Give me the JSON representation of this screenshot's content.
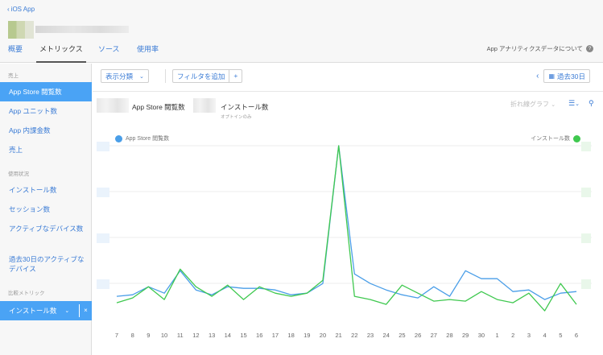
{
  "header": {
    "back_label": "iOS App",
    "about_label": "App アナリティクスデータについて",
    "help_glyph": "?"
  },
  "tabs": [
    {
      "label": "概要"
    },
    {
      "label": "メトリックス"
    },
    {
      "label": "ソース"
    },
    {
      "label": "使用率"
    }
  ],
  "sidebar": {
    "section_sales": "売上",
    "section_usage": "使用状況",
    "section_compare": "比較メトリック",
    "items_sales": [
      "App Store 閲覧数",
      "App ユニット数",
      "App 内課金数",
      "売上"
    ],
    "items_usage": [
      "インストール数",
      "セッション数",
      "アクティブなデバイス数",
      "過去30日のアクティブなデバイス"
    ],
    "compare_value": "インストール数",
    "compare_close": "×"
  },
  "toolbar": {
    "group_label": "表示分類",
    "filter_label": "フィルタを追加",
    "filter_plus": "+",
    "date_label": "過去30日"
  },
  "chart_header": {
    "metric1": "App Store 閲覧数",
    "metric2": "インストール数",
    "metric2_note": "オプトインのみ",
    "chart_type": "折れ線グラフ"
  },
  "colors": {
    "blue": "#4a9ee8",
    "green": "#3fc84f",
    "accent": "#3a7bd5",
    "sidebar_active": "#4aa3f5"
  },
  "chart_data": {
    "type": "line",
    "x": [
      "7",
      "8",
      "9",
      "10",
      "11",
      "12",
      "13",
      "14",
      "15",
      "16",
      "17",
      "18",
      "19",
      "20",
      "21",
      "22",
      "23",
      "24",
      "25",
      "26",
      "27",
      "28",
      "29",
      "30",
      "1",
      "2",
      "3",
      "4",
      "5",
      "6"
    ],
    "series": [
      {
        "name": "App Store 閲覧数",
        "axis": "left",
        "values": [
          6,
          7,
          12,
          8,
          22,
          10,
          7,
          12,
          11,
          11,
          10,
          7,
          8,
          14,
          100,
          20,
          14,
          10,
          7,
          5,
          12,
          6,
          22,
          17,
          17,
          9,
          10,
          4,
          8,
          9
        ]
      },
      {
        "name": "インストール数",
        "axis": "right",
        "values": [
          2,
          5,
          12,
          4,
          23,
          12,
          6,
          13,
          4,
          12,
          8,
          6,
          8,
          16,
          100,
          6,
          4,
          1,
          13,
          8,
          3,
          4,
          3,
          9,
          4,
          2,
          8,
          -3,
          14,
          1
        ]
      }
    ],
    "ylim": [
      -10,
      100
    ],
    "left_axis_label": "App Store 閲覧数",
    "right_axis_label": "インストール数",
    "grid": true
  }
}
